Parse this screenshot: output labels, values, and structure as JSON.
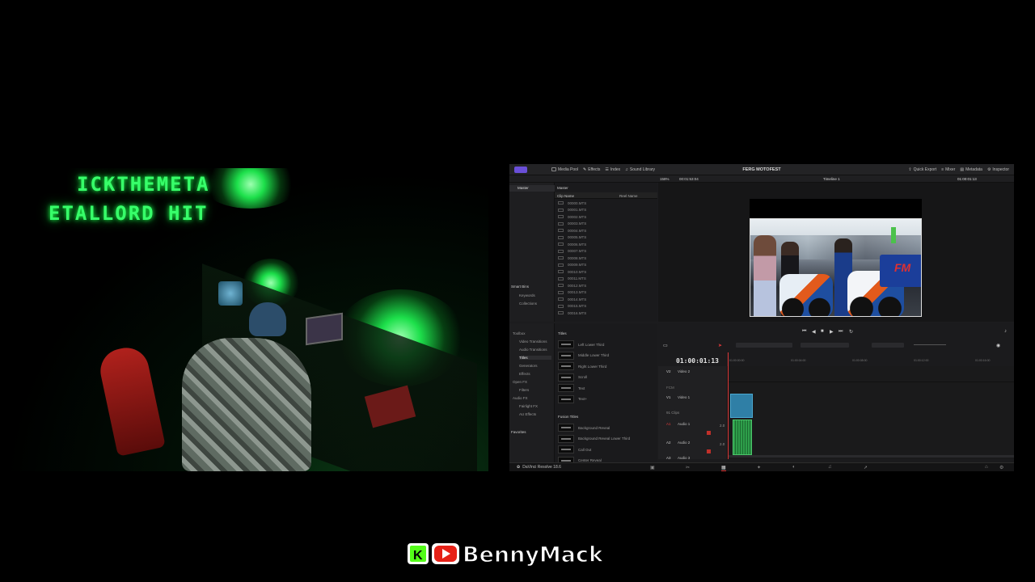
{
  "webcam": {
    "neon_line1": "ICKTHEMETA",
    "neon_line2": "ETALLORD HIT"
  },
  "resolve": {
    "topbar": {
      "media_pool": "Media Pool",
      "effects": "Effects",
      "index": "Index",
      "sound_library": "Sound Library",
      "project_title": "FERG MOTOFEST",
      "quick_export": "Quick Export",
      "mixer": "Mixer",
      "metadata": "Metadata",
      "inspector": "Inspector"
    },
    "subbar": {
      "zoom": "158%",
      "source_tc": "00:01:53:04",
      "timeline_name": "Timeline 1",
      "record_tc": "01:00:01:13"
    },
    "media_pool": {
      "root_bin": "Master",
      "list_header": "Master",
      "col_clip_name": "Clip Name",
      "col_reel_name": "Reel Name",
      "clips": [
        "00000.MTS",
        "00001.MTS",
        "00002.MTS",
        "00003.MTS",
        "00004.MTS",
        "00005.MTS",
        "00006.MTS",
        "00007.MTS",
        "00008.MTS",
        "00009.MTS",
        "00010.MTS",
        "00011.MTS",
        "00012.MTS",
        "00013.MTS",
        "00014.MTS",
        "00015.MTS",
        "00016.MTS"
      ],
      "smart_bins": "Smart Bins",
      "keywords": "Keywords",
      "collections": "Collections"
    },
    "toolbox": {
      "items": [
        "Toolbox",
        "Video Transitions",
        "Audio Transitions",
        "Titles",
        "Generators",
        "Effects",
        "Open FX",
        "Filters",
        "Audio FX",
        "Fairlight FX",
        "AU Effects"
      ],
      "favorites": "Favorites"
    },
    "effects_list": {
      "titles_header": "Titles",
      "titles": [
        "Left Lower Third",
        "Middle Lower Third",
        "Right Lower Third",
        "Scroll",
        "Text",
        "Text+"
      ],
      "fusion_header": "Fusion Titles",
      "fusion": [
        "Background Reveal",
        "Background Reveal Lower Third",
        "Call Out",
        "Center Reveal"
      ]
    },
    "timeline": {
      "timecode": "01:00:01:13",
      "ruler": [
        "01:00:00:00",
        "01:00:04:00",
        "01:00:08:00",
        "01:00:12:00",
        "01:00:16:00"
      ],
      "tracks": [
        {
          "id": "V2",
          "name": "Video 2"
        },
        {
          "id": "V1",
          "name": "Video 1",
          "clips": "1 Clip"
        },
        {
          "id": "A1",
          "name": "Audio 1",
          "level": "2.0"
        },
        {
          "id": "A2",
          "name": "Audio 2",
          "level": "2.0"
        },
        {
          "id": "A3",
          "name": "Audio 3"
        }
      ],
      "fx_label": "FCM",
      "clips_label": "91 Clips"
    },
    "app_name": "DaVinci Resolve 18.6"
  },
  "logo": {
    "text": "BennyMack"
  },
  "colors": {
    "neon_green": "#37ff6a",
    "video_clip": "#2f7fa6",
    "audio_clip": "#2e9e4a",
    "playhead": "#e03a3a",
    "youtube_red": "#e62117",
    "kick_green": "#53fc18"
  }
}
